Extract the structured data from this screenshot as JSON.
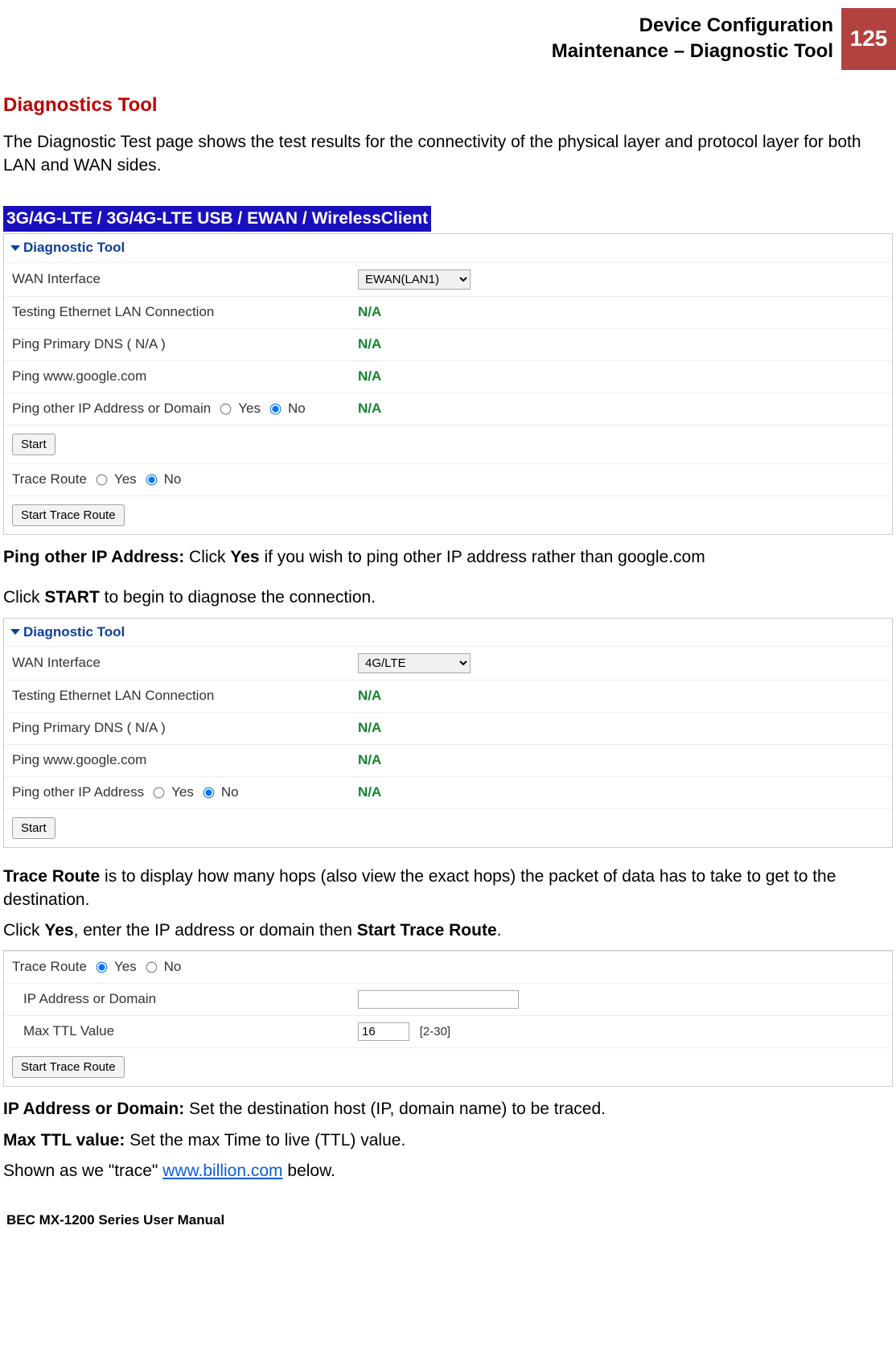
{
  "header": {
    "line1": "Device Configuration",
    "line2": "Maintenance – Diagnostic Tool",
    "page": "125"
  },
  "section_title": "Diagnostics Tool",
  "intro": "The Diagnostic Test page shows the test results for the connectivity of the physical layer and protocol layer for both LAN and WAN sides.",
  "banner": "3G/4G-LTE / 3G/4G-LTE USB / EWAN / WirelessClient",
  "panel1": {
    "title": "Diagnostic Tool",
    "rows": {
      "wan_label": "WAN Interface",
      "wan_value": "EWAN(LAN1)",
      "lan_label": "Testing Ethernet LAN Connection",
      "lan_value": "N/A",
      "dns_label": "Ping Primary DNS ( N/A )",
      "dns_value": "N/A",
      "google_label": "Ping www.google.com",
      "google_value": "N/A",
      "pingother_label": "Ping other IP Address or Domain",
      "pingother_yes": "Yes",
      "pingother_no": "No",
      "pingother_value": "N/A",
      "start": "Start",
      "trace_label": "Trace Route",
      "trace_yes": "Yes",
      "trace_no": "No",
      "start_trace": "Start Trace Route"
    }
  },
  "ping_other_label": "Ping other IP Address:",
  "ping_other_text": " Click ",
  "ping_other_yes": "Yes",
  "ping_other_suffix": " if you wish to ping other IP address rather than google.com",
  "click_start_pre": "Click ",
  "click_start_bold": "START",
  "click_start_post": " to begin to diagnose the connection.",
  "panel2": {
    "title": "Diagnostic Tool",
    "rows": {
      "wan_label": "WAN Interface",
      "wan_value": "4G/LTE",
      "lan_label": "Testing Ethernet LAN Connection",
      "lan_value": "N/A",
      "dns_label": "Ping Primary DNS ( N/A )",
      "dns_value": "N/A",
      "google_label": "Ping www.google.com",
      "google_value": "N/A",
      "pingother_label": "Ping other IP Address",
      "pingother_yes": "Yes",
      "pingother_no": "No",
      "pingother_value": "N/A",
      "start": "Start"
    }
  },
  "trace_para_bold": "Trace Route",
  "trace_para_text": " is to display how many hops (also view the exact hops) the packet of data has to take to get to the destination.",
  "trace_click_pre": "Click ",
  "trace_click_yes": "Yes",
  "trace_click_mid": ", enter the IP address or domain then ",
  "trace_click_start": "Start Trace Route",
  "trace_click_post": ".",
  "panel3": {
    "rows": {
      "trace_label": "Trace Route",
      "trace_yes": "Yes",
      "trace_no": "No",
      "ip_label": "IP Address or Domain",
      "ip_value": "",
      "ttl_label": "Max TTL Value",
      "ttl_value": "16",
      "ttl_range": "[2-30]",
      "start_trace": "Start Trace Route"
    }
  },
  "ip_desc_label": "IP Address or Domain:",
  "ip_desc_text": " Set the destination host (IP, domain name) to be traced.",
  "ttl_desc_label": "Max TTL value:",
  "ttl_desc_text": " Set the max Time to live (TTL) value.",
  "shown_pre": "Shown as we \"trace\" ",
  "shown_link": "www.billion.com",
  "shown_post": " below.",
  "footer": "BEC MX-1200 Series User Manual"
}
